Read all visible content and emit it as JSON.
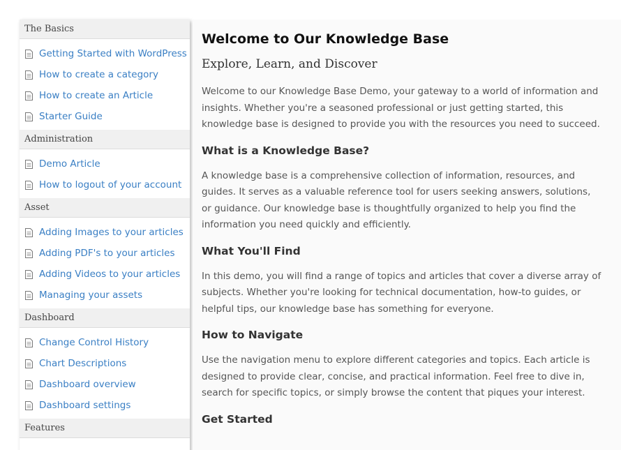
{
  "sidebar": {
    "categories": [
      {
        "title": "The Basics",
        "articles": [
          "Getting Started with WordPress",
          "How to create a category",
          "How to create an Article",
          "Starter Guide"
        ]
      },
      {
        "title": "Administration",
        "articles": [
          "Demo Article",
          "How to logout of your account"
        ]
      },
      {
        "title": "Asset",
        "articles": [
          "Adding Images to your articles",
          "Adding PDF's to your articles",
          "Adding Videos to your articles",
          "Managing your assets"
        ]
      },
      {
        "title": "Dashboard",
        "articles": [
          "Change Control History",
          "Chart Descriptions",
          "Dashboard overview",
          "Dashboard settings"
        ]
      },
      {
        "title": "Features",
        "articles": []
      }
    ]
  },
  "main": {
    "title": "Welcome to Our Knowledge Base",
    "subtitle": "Explore, Learn, and Discover",
    "intro": "Welcome to our Knowledge Base Demo, your gateway to a world of information and insights. Whether you're a seasoned professional or just getting started, this knowledge base is designed to provide you with the resources you need to succeed.",
    "sections": [
      {
        "heading": "What is a Knowledge Base?",
        "text": "A knowledge base is a comprehensive collection of information, resources, and guides. It serves as a valuable reference tool for users seeking answers, solutions, or guidance. Our knowledge base is thoughtfully organized to help you find the information you need quickly and efficiently."
      },
      {
        "heading": "What You'll Find",
        "text": "In this demo, you will find a range of topics and articles that cover a diverse array of subjects. Whether you're looking for technical documentation, how-to guides, or helpful tips, our knowledge base has something for everyone."
      },
      {
        "heading": "How to Navigate",
        "text": "Use the navigation menu to explore different categories and topics. Each article is designed to provide clear, concise, and practical information. Feel free to dive in, search for specific topics, or simply browse the content that piques your interest."
      },
      {
        "heading": "Get Started",
        "text": ""
      }
    ]
  },
  "colors": {
    "link": "#3a7fc4",
    "category_header_bg": "#f0f0f0",
    "content_bg": "#fafafa",
    "body_text": "#555555"
  },
  "icons": {
    "article": "document-icon"
  }
}
